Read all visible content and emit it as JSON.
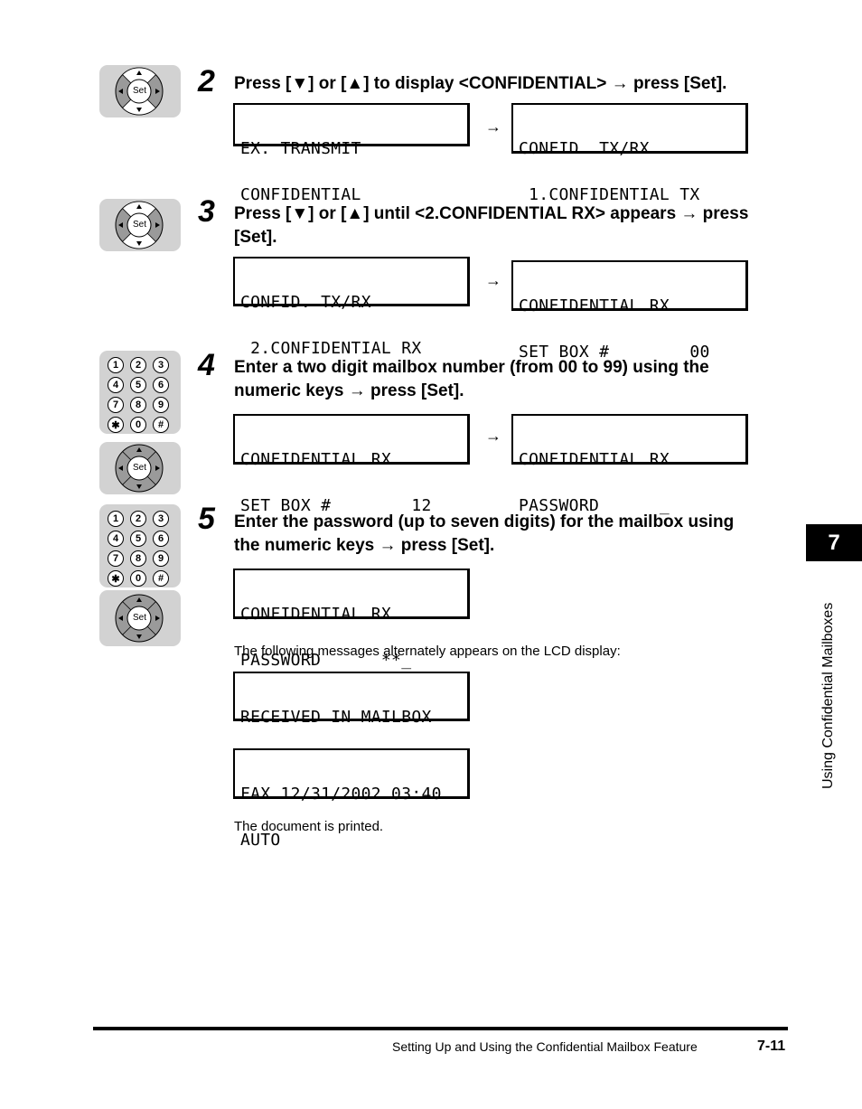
{
  "steps": [
    {
      "number": "2",
      "instruction": "Press [▼] or [▲] to display <CONFIDENTIAL> → press [Set].",
      "icons": [
        "set-dpad"
      ],
      "displays": [
        {
          "line1": "EX. TRANSMIT",
          "line2": "CONFIDENTIAL"
        },
        {
          "line1": "CONFID. TX/RX",
          "line2": " 1.CONFIDENTIAL TX"
        }
      ]
    },
    {
      "number": "3",
      "instruction_line1": "Press [▼] or [▲] until <2.CONFIDENTIAL RX> appears → press",
      "instruction_line2": "[Set].",
      "icons": [
        "set-dpad"
      ],
      "displays": [
        {
          "line1": "CONFID. TX/RX",
          "line2": " 2.CONFIDENTIAL RX"
        },
        {
          "line1": "CONFIDENTIAL RX",
          "line2": "SET BOX #        00"
        }
      ]
    },
    {
      "number": "4",
      "instruction_line1": "Enter a two digit mailbox number (from 00 to 99) using the",
      "instruction_line2": "numeric keys → press [Set].",
      "icons": [
        "numeric-keypad",
        "set-dpad"
      ],
      "displays": [
        {
          "line1": "CONFIDENTIAL RX",
          "line2": "SET BOX #        12"
        },
        {
          "line1": "CONFIDENTIAL RX",
          "line2": "PASSWORD      _"
        }
      ]
    },
    {
      "number": "5",
      "instruction_line1": "Enter the password (up to seven digits) for the mailbox using",
      "instruction_line2": "the numeric keys → press [Set].",
      "icons": [
        "numeric-keypad",
        "set-dpad"
      ],
      "displays": [
        {
          "line1": "CONFIDENTIAL RX",
          "line2": "PASSWORD      **_"
        }
      ],
      "note": "The following messages alternately appears on the LCD display:",
      "alternate_displays": [
        {
          "line1": "RECEIVED IN MAILBOX",
          "line2": ""
        },
        {
          "line1": "FAX 12/31/2002 03:40",
          "line2": "AUTO"
        }
      ],
      "result": "The document is printed."
    }
  ],
  "keypad_keys": [
    "1",
    "2",
    "3",
    "4",
    "5",
    "6",
    "7",
    "8",
    "9",
    "✱",
    "0",
    "#"
  ],
  "set_label": "Set",
  "arrow_symbol": "→",
  "side_tab": {
    "chapter": "7",
    "title": "Using Confidential Mailboxes"
  },
  "footer": {
    "title": "Setting Up and Using the Confidential Mailbox Feature",
    "page": "7-11"
  }
}
